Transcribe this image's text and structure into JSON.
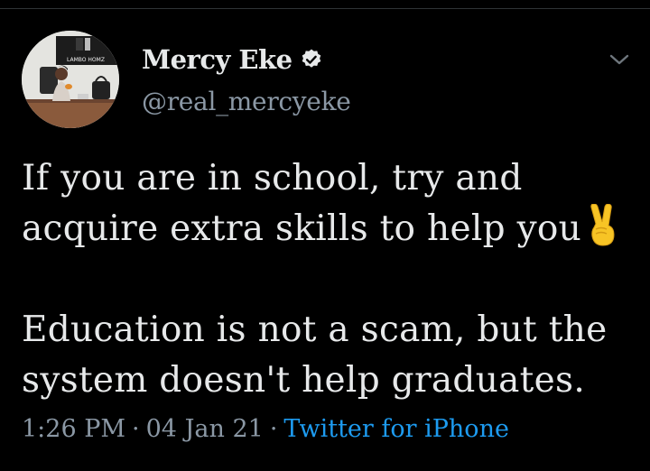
{
  "author": {
    "display_name": "Mercy Eke",
    "handle": "@real_mercyeke",
    "verified": true,
    "avatar_icon": "profile-photo",
    "avatar_sign_text": "LAMBO HOMZ"
  },
  "tweet": {
    "paragraphs": [
      {
        "lines": [
          "If you are in school, try and",
          "acquire extra skills to help you"
        ],
        "trailing_emoji": "victory-hand-emoji"
      },
      {
        "lines": [
          "Education is not a scam, but the",
          "system doesn't help graduates."
        ]
      }
    ]
  },
  "meta": {
    "time": "1:26 PM",
    "separator": "·",
    "date": "04 Jan 21",
    "source": "Twitter for iPhone"
  },
  "colors": {
    "background": "#000000",
    "text_primary": "#e7e9ea",
    "text_secondary": "#8b98a5",
    "link": "#1d9bf0",
    "verified_badge": "#e7e9ea"
  },
  "icons": {
    "verified": "verified-badge-icon",
    "menu": "chevron-down-icon"
  }
}
